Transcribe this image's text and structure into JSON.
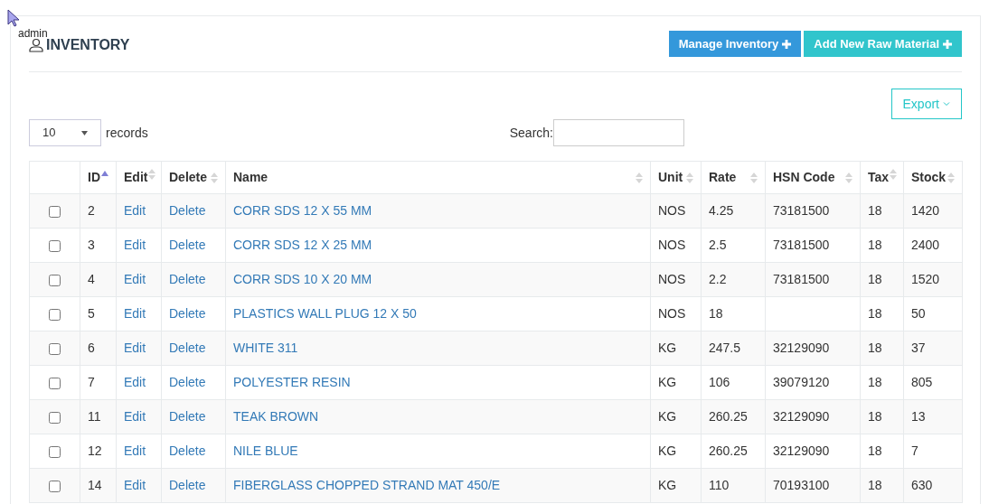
{
  "tooltip": "admin",
  "header": {
    "title": "INVENTORY",
    "buttons": [
      {
        "label": "Manage Inventory",
        "kind": "primary"
      },
      {
        "label": "Add New Raw Material",
        "kind": "info"
      }
    ]
  },
  "export": {
    "label": "Export"
  },
  "length": {
    "value": "10",
    "label": "records"
  },
  "search": {
    "label": "Search:"
  },
  "table": {
    "columns": [
      {
        "label": "ID",
        "sortable": true,
        "sorted_ascending": true
      },
      {
        "label": "Edit",
        "sortable": true,
        "sorted_ascending": false
      },
      {
        "label": "Delete",
        "sortable": true,
        "sorted_ascending": false
      },
      {
        "label": "Name",
        "sortable": true,
        "sorted_ascending": false
      },
      {
        "label": "Unit",
        "sortable": true,
        "sorted_ascending": false
      },
      {
        "label": "Rate",
        "sortable": true,
        "sorted_ascending": false
      },
      {
        "label": "HSN Code",
        "sortable": true,
        "sorted_ascending": false
      },
      {
        "label": "Tax",
        "sortable": true,
        "sorted_ascending": false
      },
      {
        "label": "Stock",
        "sortable": true,
        "sorted_ascending": false
      }
    ],
    "rows": [
      {
        "checked": false,
        "id": "2",
        "edit": "Edit",
        "delete": "Delete",
        "name": "CORR SDS 12 X 55 MM",
        "unit": "NOS",
        "rate": "4.25",
        "hsn": "73181500",
        "tax": "18",
        "stock": "1420"
      },
      {
        "checked": false,
        "id": "3",
        "edit": "Edit",
        "delete": "Delete",
        "name": "CORR SDS 12 X 25 MM",
        "unit": "NOS",
        "rate": "2.5",
        "hsn": "73181500",
        "tax": "18",
        "stock": "2400"
      },
      {
        "checked": false,
        "id": "4",
        "edit": "Edit",
        "delete": "Delete",
        "name": "CORR SDS 10 X 20 MM",
        "unit": "NOS",
        "rate": "2.2",
        "hsn": "73181500",
        "tax": "18",
        "stock": "1520"
      },
      {
        "checked": false,
        "id": "5",
        "edit": "Edit",
        "delete": "Delete",
        "name": "PLASTICS WALL PLUG 12 X 50",
        "unit": "NOS",
        "rate": "18",
        "tax": "18",
        "stock": "50"
      },
      {
        "checked": false,
        "id": "6",
        "edit": "Edit",
        "delete": "Delete",
        "name": "WHITE 311",
        "unit": "KG",
        "rate": "247.5",
        "hsn": "32129090",
        "tax": "18",
        "stock": "37"
      },
      {
        "checked": false,
        "id": "7",
        "edit": "Edit",
        "delete": "Delete",
        "name": "POLYESTER RESIN",
        "unit": "KG",
        "rate": "106",
        "hsn": "39079120",
        "tax": "18",
        "stock": "805"
      },
      {
        "checked": false,
        "id": "11",
        "edit": "Edit",
        "delete": "Delete",
        "name": "TEAK BROWN",
        "unit": "KG",
        "rate": "260.25",
        "hsn": "32129090",
        "tax": "18",
        "stock": "13"
      },
      {
        "checked": false,
        "id": "12",
        "edit": "Edit",
        "delete": "Delete",
        "name": "NILE BLUE",
        "unit": "KG",
        "rate": "260.25",
        "hsn": "32129090",
        "tax": "18",
        "stock": "7"
      },
      {
        "checked": false,
        "id": "14",
        "edit": "Edit",
        "delete": "Delete",
        "name": "FIBERGLASS CHOPPED STRAND MAT 450/E",
        "unit": "KG",
        "rate": "110",
        "hsn": "70193100",
        "tax": "18",
        "stock": "630"
      }
    ]
  }
}
